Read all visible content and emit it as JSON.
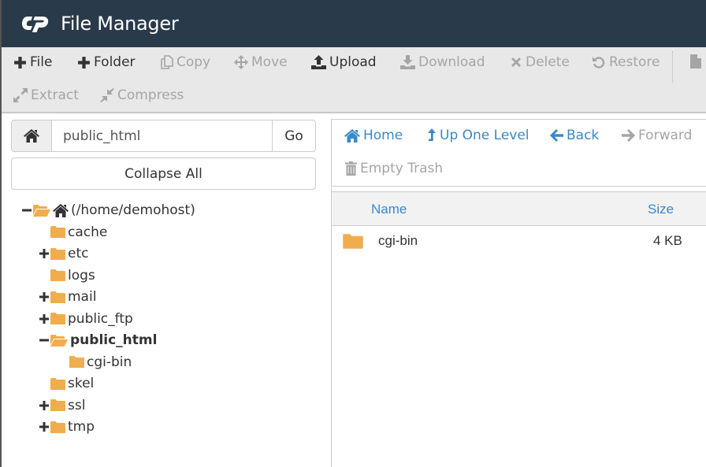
{
  "header": {
    "title": "File Manager",
    "logo_icon": "cpanel-logo-icon"
  },
  "toolbar": {
    "row1": [
      {
        "id": "file",
        "label": "File",
        "icon": "plus-icon",
        "enabled": true
      },
      {
        "id": "folder",
        "label": "Folder",
        "icon": "plus-icon",
        "enabled": true
      },
      {
        "id": "copy",
        "label": "Copy",
        "icon": "copy-icon",
        "enabled": false
      },
      {
        "id": "move",
        "label": "Move",
        "icon": "move-arrows-icon",
        "enabled": false
      },
      {
        "id": "upload",
        "label": "Upload",
        "icon": "upload-icon",
        "enabled": true
      },
      {
        "id": "download",
        "label": "Download",
        "icon": "download-icon",
        "enabled": false
      },
      {
        "id": "delete",
        "label": "Delete",
        "icon": "x-icon",
        "enabled": false
      },
      {
        "id": "restore",
        "label": "Restore",
        "icon": "undo-icon",
        "enabled": false
      },
      {
        "id": "more",
        "label": "",
        "icon": "file-icon",
        "enabled": false
      }
    ],
    "row2": [
      {
        "id": "extract",
        "label": "Extract",
        "icon": "expand-icon",
        "enabled": false
      },
      {
        "id": "compress",
        "label": "Compress",
        "icon": "compress-icon",
        "enabled": false
      }
    ]
  },
  "left_pane": {
    "path_value": "public_html",
    "go_label": "Go",
    "collapse_label": "Collapse All",
    "tree": [
      {
        "label": "(/home/demohost)",
        "level": 0,
        "toggle": "minus",
        "open": true,
        "home": true,
        "bold": false
      },
      {
        "label": "cache",
        "level": 1,
        "toggle": "",
        "open": false,
        "bold": false
      },
      {
        "label": "etc",
        "level": 1,
        "toggle": "plus",
        "open": false,
        "bold": false
      },
      {
        "label": "logs",
        "level": 1,
        "toggle": "",
        "open": false,
        "bold": false
      },
      {
        "label": "mail",
        "level": 1,
        "toggle": "plus",
        "open": false,
        "bold": false
      },
      {
        "label": "public_ftp",
        "level": 1,
        "toggle": "plus",
        "open": false,
        "bold": false
      },
      {
        "label": "public_html",
        "level": 1,
        "toggle": "minus",
        "open": true,
        "bold": true
      },
      {
        "label": "cgi-bin",
        "level": 2,
        "toggle": "",
        "open": false,
        "bold": false
      },
      {
        "label": "skel",
        "level": 1,
        "toggle": "",
        "open": false,
        "bold": false
      },
      {
        "label": "ssl",
        "level": 1,
        "toggle": "plus",
        "open": false,
        "bold": false
      },
      {
        "label": "tmp",
        "level": 1,
        "toggle": "plus",
        "open": false,
        "bold": false
      }
    ]
  },
  "nav": {
    "home": "Home",
    "up": "Up One Level",
    "back": "Back",
    "forward": "Forward",
    "empty_trash": "Empty Trash"
  },
  "file_table": {
    "columns": [
      "Name",
      "Size"
    ],
    "rows": [
      {
        "name": "cgi-bin",
        "size": "4 KB",
        "type": "folder"
      }
    ]
  },
  "colors": {
    "header_bg": "#293a4a",
    "accent_blue": "#3b88c8",
    "folder": "#f0ad4e",
    "disabled": "#a5a5a5"
  }
}
